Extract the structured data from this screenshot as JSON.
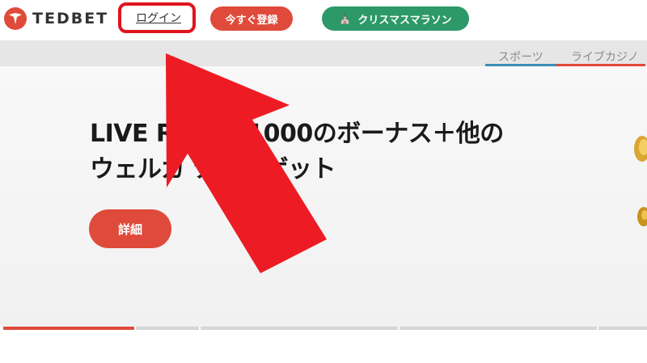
{
  "brand": {
    "name": "TEDBET"
  },
  "header": {
    "login_label": "ログイン",
    "register_label": "今すぐ登録",
    "xmas_label": "クリスマスマラソン"
  },
  "subnav": {
    "tabs": [
      {
        "label": "スポーツ",
        "accent": "#3a8fb7"
      },
      {
        "label": "ライブカジノ",
        "accent": "#e04a3a"
      }
    ]
  },
  "hero": {
    "title_line1": "LIVE R          E へ¥1000のボーナス＋他の",
    "title_line2": "ウェルカ          ナスをゲット",
    "details_label": "詳細"
  },
  "slider": {
    "slides": 4,
    "active_index": 0
  },
  "colors": {
    "brand_red": "#e04a3a",
    "xmas_green": "#2d9968",
    "annotation_red": "#e0141e"
  },
  "icons": {
    "logo": "tedbet-logo-icon",
    "tree": "christmas-tree-icon",
    "arrow": "annotation-arrow"
  }
}
